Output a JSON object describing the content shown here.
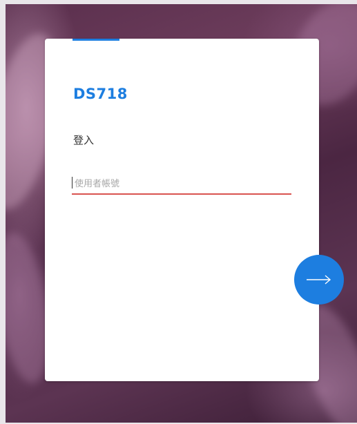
{
  "login": {
    "hostname": "DS718",
    "title": "登入",
    "username_placeholder": "使用者帳號",
    "username_value": "",
    "next_icon": "arrow-right-icon"
  },
  "colors": {
    "accent": "#1d7ee0",
    "input_underline_error": "#d9534f",
    "card_background": "#ffffff"
  }
}
